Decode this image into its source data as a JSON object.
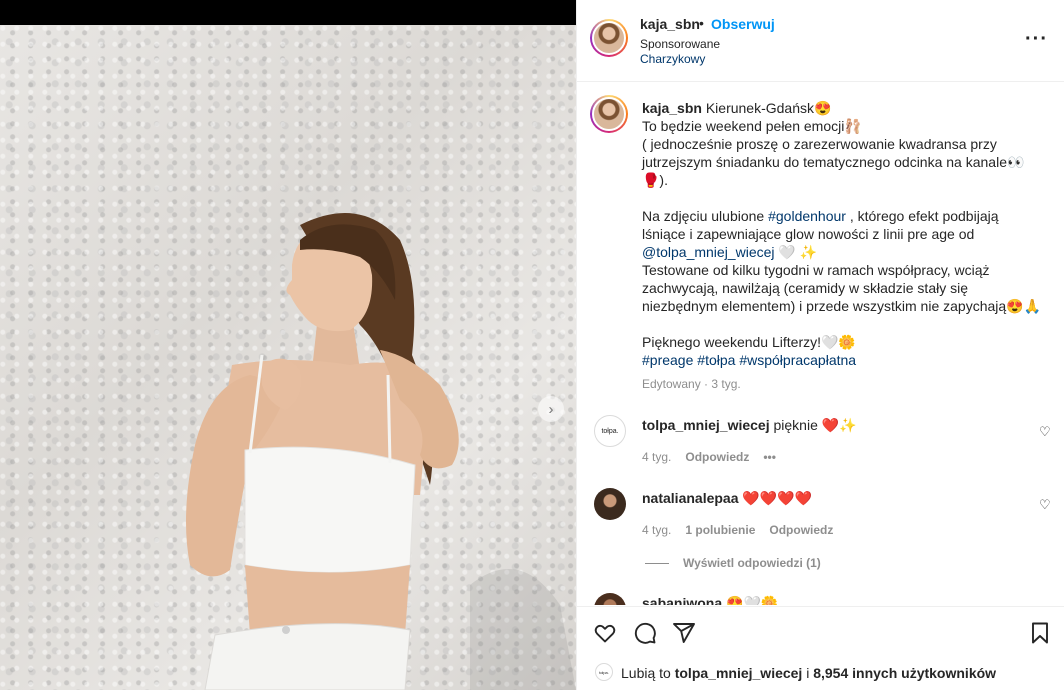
{
  "post": {
    "username": "kaja_sbn",
    "dot": "•",
    "follow_label": "Obserwuj",
    "sponsored_label": "Sponsorowane",
    "partner_label": "Charzykowy",
    "more_icon": "more-horizontal-icon"
  },
  "caption": {
    "username": "kaja_sbn",
    "line1": "Kierunek-Gdańsk😍",
    "line2": "To będzie weekend pełen emocji🩰",
    "line3": "( jednocześnie proszę o zarezerwowanie kwadransa przy jutrzejszym śniadanku do tematycznego odcinka na kanale👀🥊).",
    "p2_a": "Na zdjęciu ulubione ",
    "p2_tag": "#goldenhour",
    "p2_b": " , którego efekt podbijają lśniące i zapewniające glow nowości z linii pre age od ",
    "p2_mention": "@tolpa_mniej_wiecej",
    "p2_c": " 🤍 ✨",
    "p3": "Testowane od kilku tygodni w ramach współpracy, wciąż zachwycają, nawilżają (ceramidy w składzie stały się niezbędnym elementem) i przede wszystkim nie zapychają😍🙏",
    "p4": "Pięknego weekendu Lifterzy!🤍🌼",
    "tags": [
      "#preage",
      "#tołpa",
      "#współpracapłatna"
    ],
    "meta": "Edytowany · 3 tyg."
  },
  "comments": [
    {
      "username": "tolpa_mniej_wiecej",
      "text": "pięknie ❤️✨",
      "time": "4 tyg.",
      "reply_label": "Odpowiedz",
      "more": "•••",
      "avatar_text": "tołpa."
    },
    {
      "username": "natalianalepaa",
      "text": "❤️❤️❤️❤️",
      "time": "4 tyg.",
      "likes": "1 polubienie",
      "reply_label": "Odpowiedz",
      "view_replies": "Wyświetl odpowiedzi (1)"
    },
    {
      "username": "sabaniwona",
      "text": "😍🤍🌼"
    }
  ],
  "actions": {
    "icons": [
      "heart-icon",
      "comment-icon",
      "share-icon",
      "bookmark-icon"
    ]
  },
  "likes": {
    "prefix": "Lubią to ",
    "user": "tolpa_mniej_wiecej",
    "middle": " i ",
    "others": "8,954 innych użytkowników",
    "avatar_text": "tołpa."
  },
  "colors": {
    "accent": "#0095f6",
    "link": "#00376b",
    "muted": "#8e8e8e",
    "text": "#262626"
  }
}
